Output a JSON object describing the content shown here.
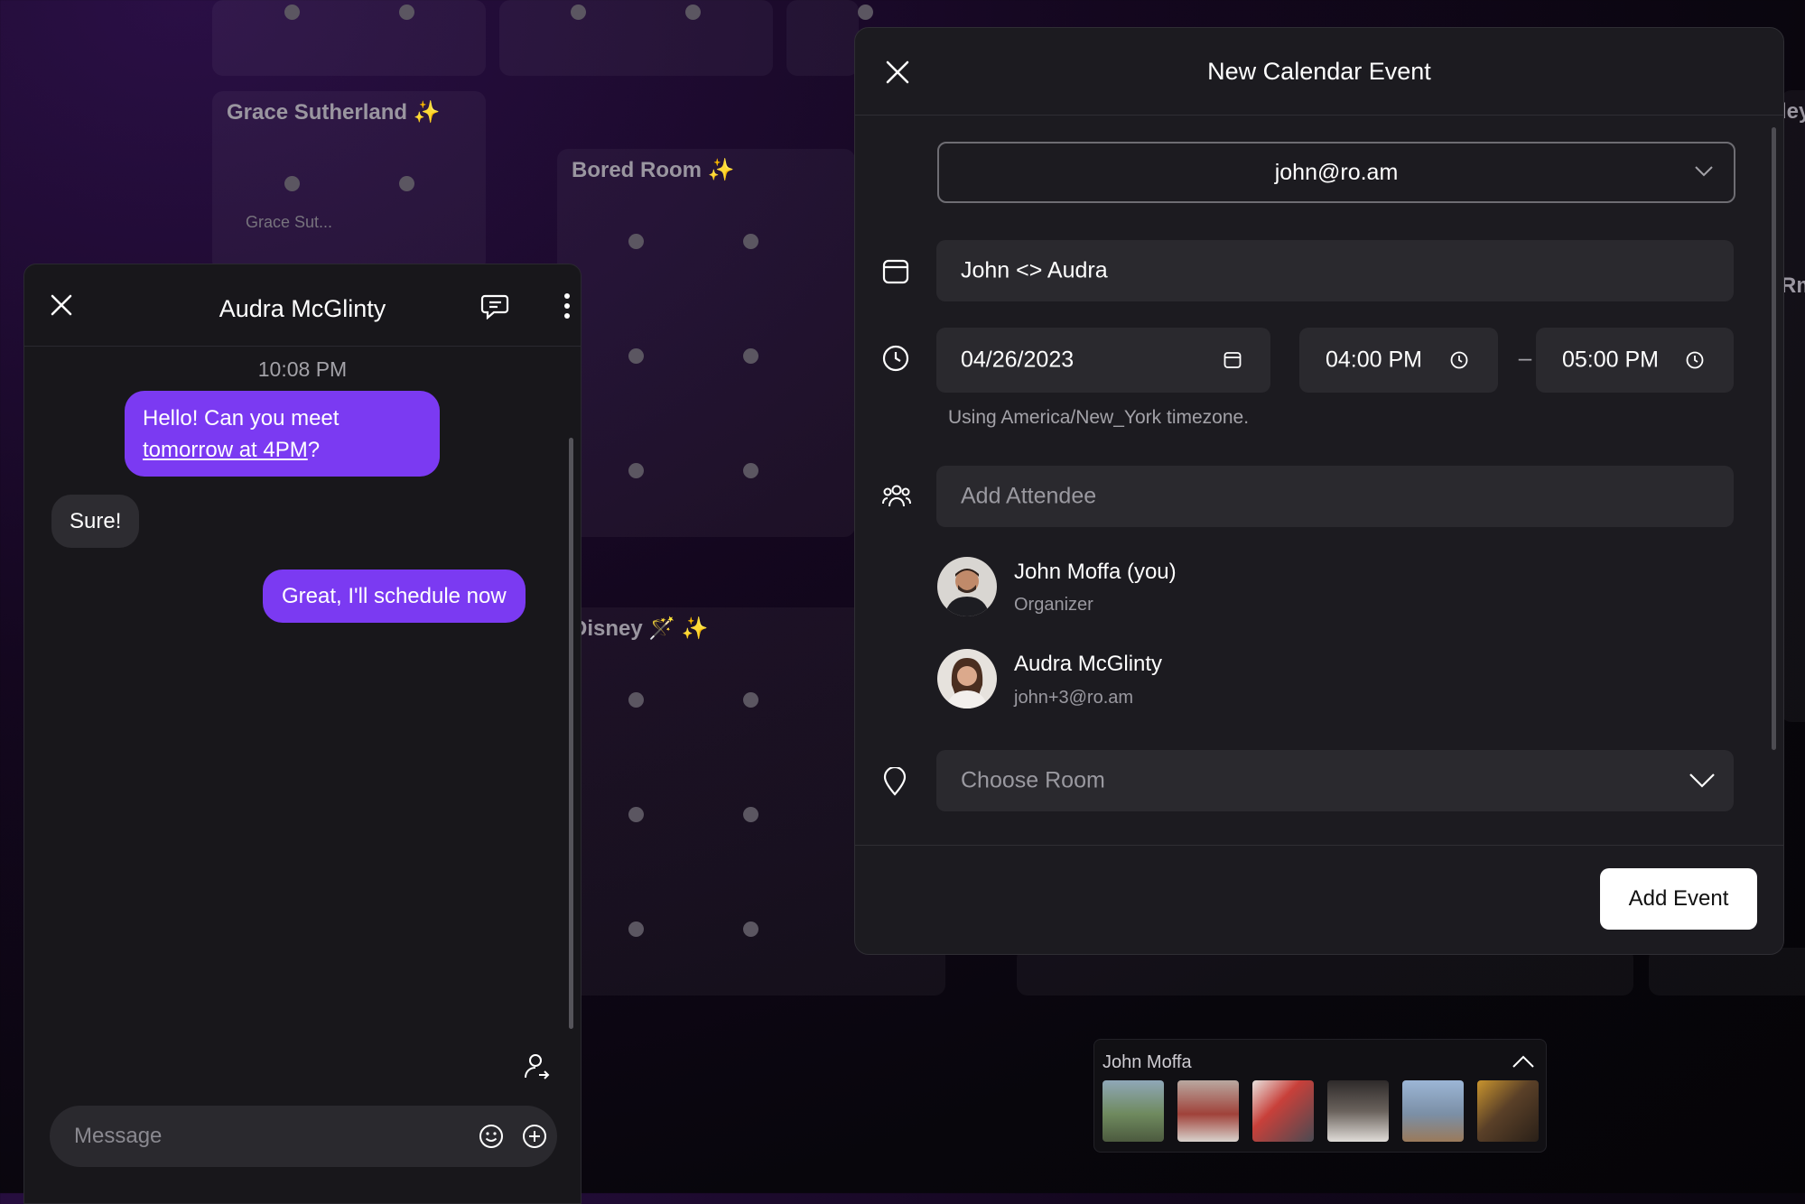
{
  "background": {
    "rooms": [
      {
        "name": "Grace Sutherland ✨",
        "occupant": "Grace Sut..."
      },
      {
        "name": "Bored Room ✨"
      },
      {
        "name": "Disney 🪄 ✨"
      },
      {
        "name_fragment_right_1": "ley"
      },
      {
        "name_fragment_right_2": "Rm"
      }
    ]
  },
  "chat": {
    "title": "Audra McGlinty",
    "timestamp": "10:08 PM",
    "messages": [
      {
        "from": "me",
        "text_before": "Hello! Can you meet ",
        "link": "tomorrow at 4PM",
        "text_after": "?"
      },
      {
        "from": "them",
        "text": "Sure!"
      },
      {
        "from": "me",
        "text": "Great, I'll schedule now"
      }
    ],
    "input_placeholder": "Message"
  },
  "event_modal": {
    "title": "New Calendar Event",
    "account": "john@ro.am",
    "event_title": "John <> Audra",
    "date": "04/26/2023",
    "start_time": "04:00 PM",
    "time_separator": "–",
    "end_time": "05:00 PM",
    "timezone_note": "Using America/New_York timezone.",
    "attendee_placeholder": "Add Attendee",
    "attendees": [
      {
        "name": "John Moffa (you)",
        "detail": "Organizer"
      },
      {
        "name": "Audra McGlinty",
        "detail": "john+3@ro.am"
      }
    ],
    "room_placeholder": "Choose Room",
    "submit_label": "Add Event"
  },
  "photo_strip": {
    "name": "John Moffa",
    "photo_count": 6
  },
  "colors": {
    "accent": "#7b3af2",
    "panel": "#1c1b20"
  }
}
